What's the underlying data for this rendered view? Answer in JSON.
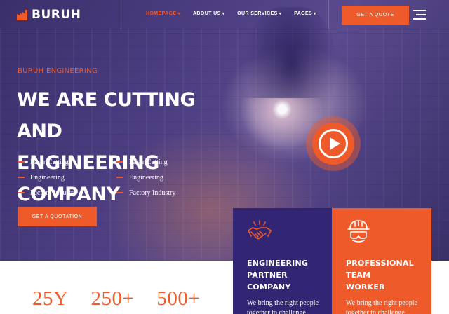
{
  "brand": {
    "name": "BURUH"
  },
  "nav": {
    "items": [
      {
        "label": "HOMEPAGE",
        "has_dropdown": true,
        "active": true
      },
      {
        "label": "ABOUT US",
        "has_dropdown": true,
        "active": false
      },
      {
        "label": "OUR SERVICES",
        "has_dropdown": true,
        "active": false
      },
      {
        "label": "PAGES",
        "has_dropdown": true,
        "active": false
      }
    ],
    "quote_button": "GET A QUOTE"
  },
  "hero": {
    "eyebrow": "BURUH ENGINEERING",
    "headline_line1": "WE ARE CUTTING AND",
    "headline_line2": "ENGINEERING COMPANY",
    "features_left": [
      "Laser Cutting",
      "Engineering",
      "Factory Industry"
    ],
    "features_right": [
      "Laser Cutting",
      "Engineering",
      "Factory Industry"
    ],
    "cta": "GET A QUOTATION"
  },
  "stats": [
    "25Y",
    "250+",
    "500+"
  ],
  "cards": [
    {
      "title_line1": "ENGINEERING",
      "title_line2": "PARTNER COMPANY",
      "desc": "We bring the right people together to challenge established",
      "icon": "handshake-icon"
    },
    {
      "title_line1": "PROFESSIONAL TEAM",
      "title_line2": "WORKER",
      "desc": "We bring the right people together to challenge established",
      "icon": "worker-helmet-icon"
    }
  ],
  "colors": {
    "accent": "#ef5a2a",
    "purple": "#322674",
    "hero_overlay": "#4b3d80"
  }
}
